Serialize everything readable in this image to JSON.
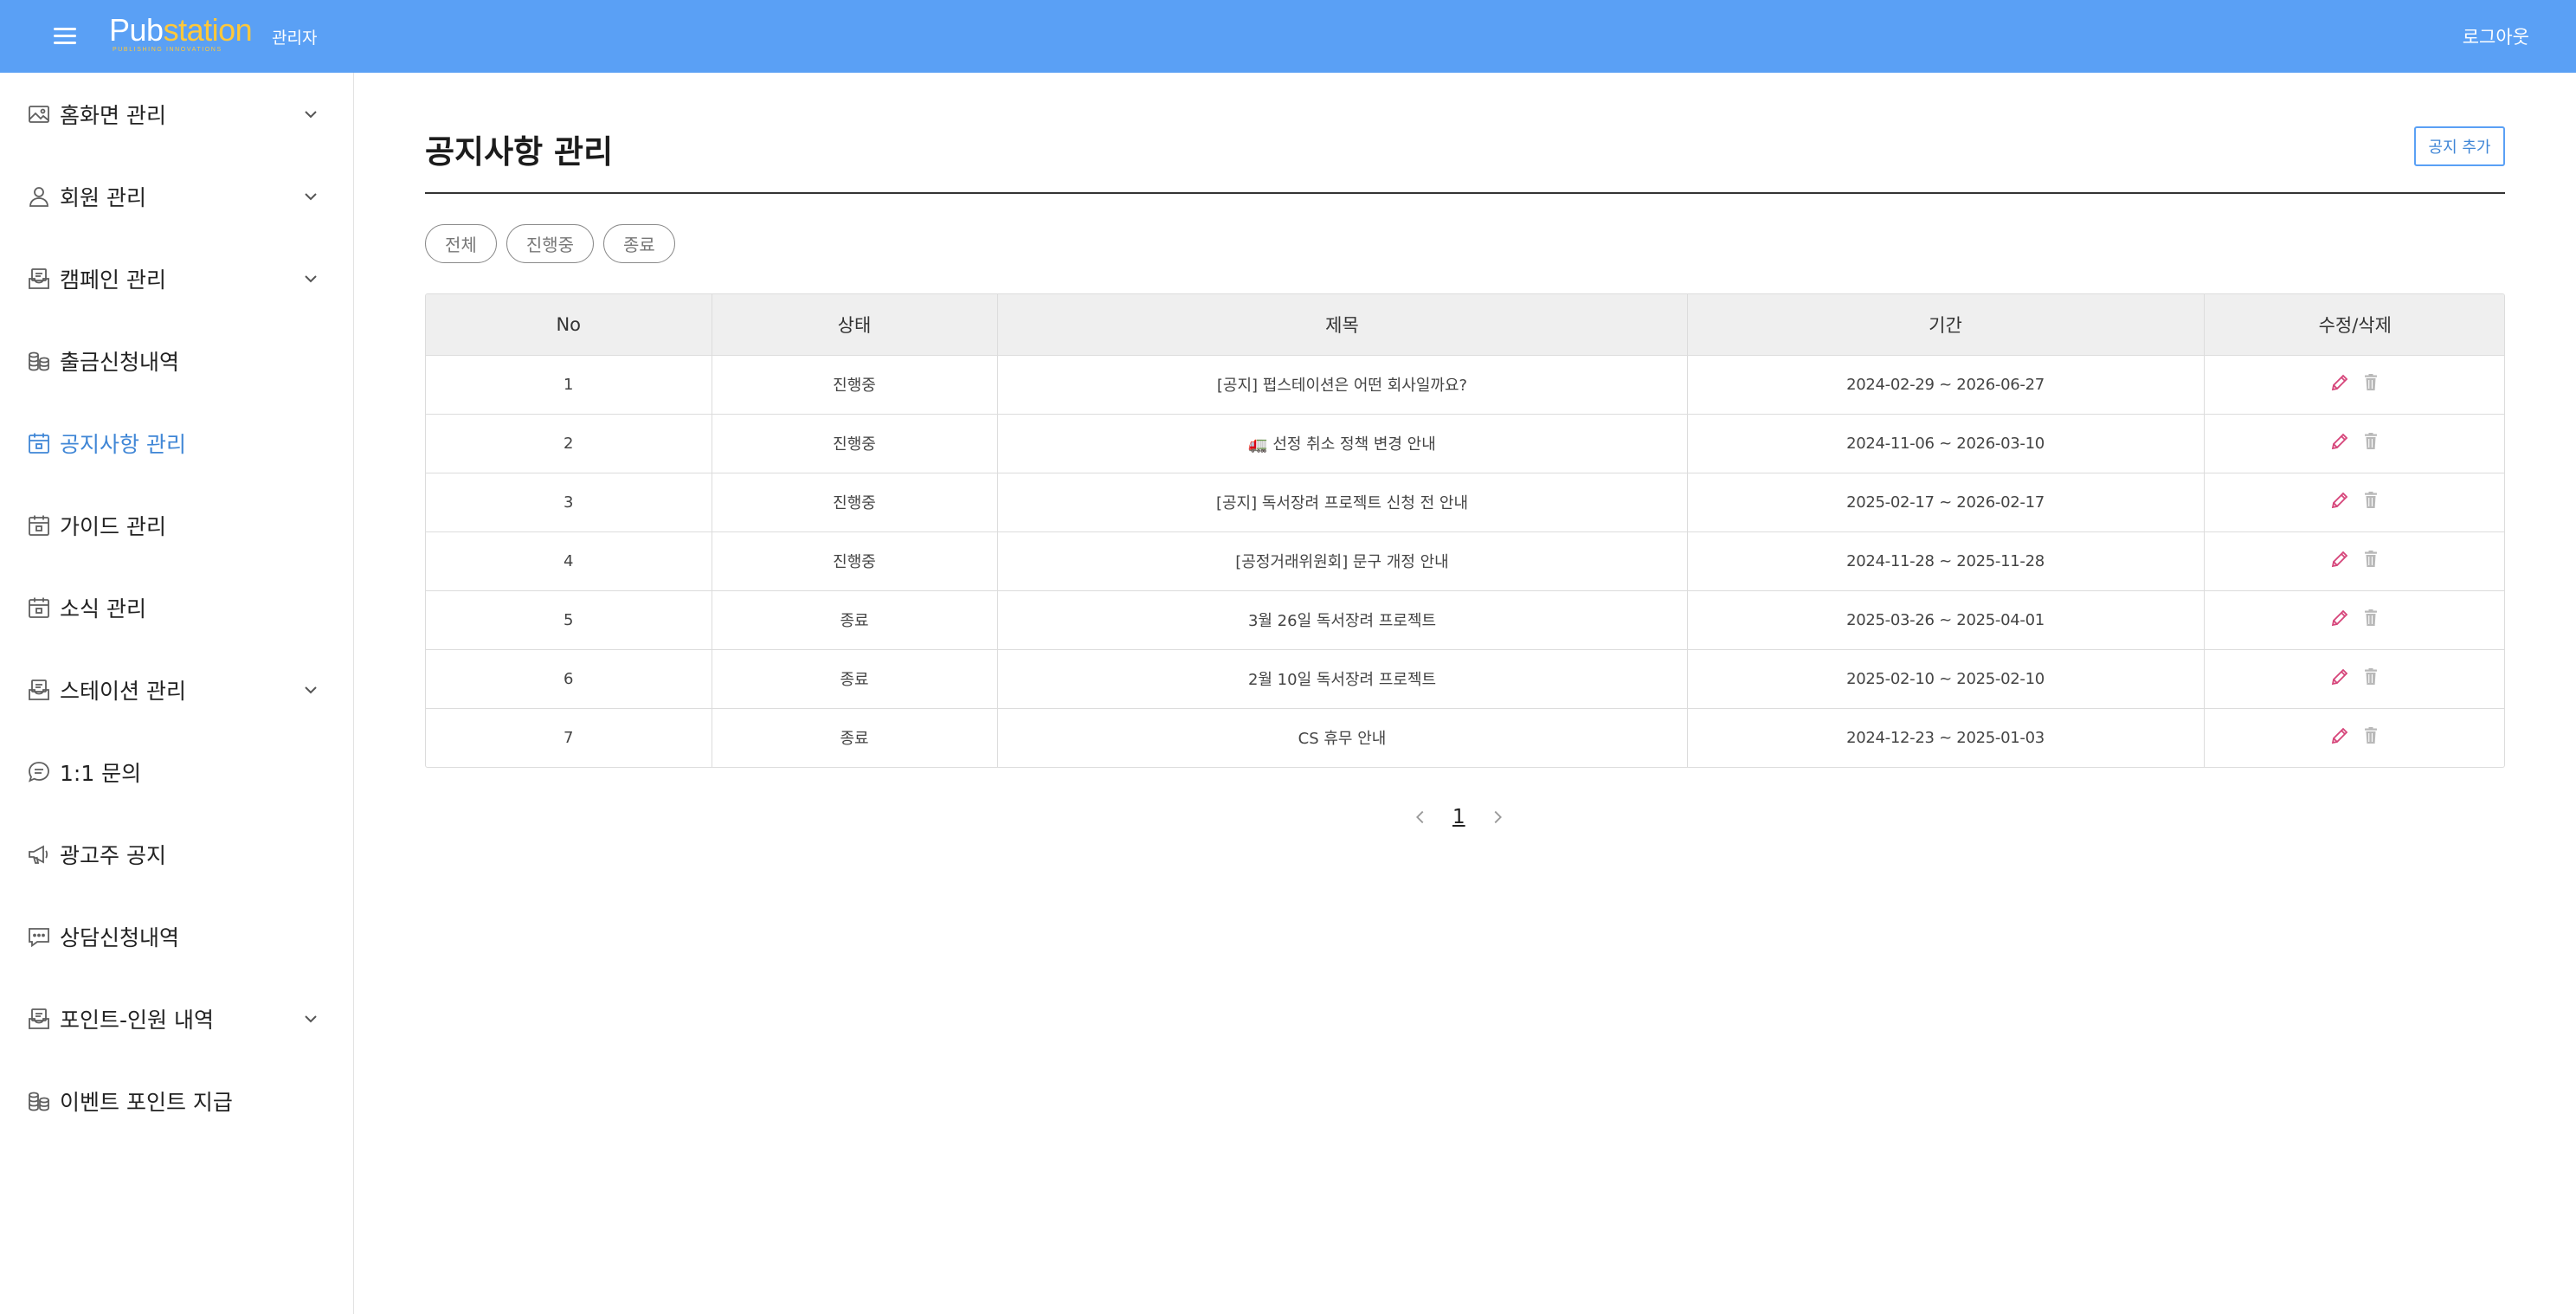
{
  "header": {
    "logo_text_a": "Pub",
    "logo_text_b": "station",
    "logo_tagline": "PUBLISHING INNOVATIONS",
    "role": "관리자",
    "logout": "로그아웃",
    "bar_color": "#5aa0f5"
  },
  "sidebar": {
    "items": [
      {
        "label": "홈화면 관리",
        "icon": "image-icon",
        "expandable": true,
        "active": false
      },
      {
        "label": "회원 관리",
        "icon": "user-icon",
        "expandable": true,
        "active": false
      },
      {
        "label": "캠페인 관리",
        "icon": "inbox-icon",
        "expandable": true,
        "active": false
      },
      {
        "label": "출금신청내역",
        "icon": "coins-icon",
        "expandable": false,
        "active": false
      },
      {
        "label": "공지사항 관리",
        "icon": "calendar-icon",
        "expandable": false,
        "active": true
      },
      {
        "label": "가이드 관리",
        "icon": "calendar-icon",
        "expandable": false,
        "active": false
      },
      {
        "label": "소식 관리",
        "icon": "calendar-icon",
        "expandable": false,
        "active": false
      },
      {
        "label": "스테이션 관리",
        "icon": "inbox-icon",
        "expandable": true,
        "active": false
      },
      {
        "label": "1:1 문의",
        "icon": "chat-icon",
        "expandable": false,
        "active": false
      },
      {
        "label": "광고주 공지",
        "icon": "megaphone-icon",
        "expandable": false,
        "active": false
      },
      {
        "label": "상담신청내역",
        "icon": "message-dots-icon",
        "expandable": false,
        "active": false
      },
      {
        "label": "포인트-인원 내역",
        "icon": "inbox-icon",
        "expandable": true,
        "active": false
      },
      {
        "label": "이벤트 포인트 지급",
        "icon": "coins-icon",
        "expandable": false,
        "active": false
      }
    ],
    "active_color": "#3f86d6"
  },
  "main": {
    "title": "공지사항 관리",
    "add_button": "공지 추가",
    "filters": [
      "전체",
      "진행중",
      "종료"
    ],
    "table": {
      "columns": [
        "No",
        "상태",
        "제목",
        "기간",
        "수정/삭제"
      ],
      "rows": [
        {
          "no": "1",
          "status": "진행중",
          "title": "[공지] 펍스테이션은 어떤 회사일까요?",
          "period": "2024-02-29 ~ 2026-06-27"
        },
        {
          "no": "2",
          "status": "진행중",
          "title": "🚛 선정 취소 정책 변경 안내",
          "period": "2024-11-06 ~ 2026-03-10"
        },
        {
          "no": "3",
          "status": "진행중",
          "title": "[공지] 독서장려 프로젝트 신청 전 안내",
          "period": "2025-02-17 ~ 2026-02-17"
        },
        {
          "no": "4",
          "status": "진행중",
          "title": "[공정거래위원회] 문구 개정 안내",
          "period": "2024-11-28 ~ 2025-11-28"
        },
        {
          "no": "5",
          "status": "종료",
          "title": "3월 26일 독서장려 프로젝트",
          "period": "2025-03-26 ~ 2025-04-01"
        },
        {
          "no": "6",
          "status": "종료",
          "title": "2월 10일 독서장려 프로젝트",
          "period": "2025-02-10 ~ 2025-02-10"
        },
        {
          "no": "7",
          "status": "종료",
          "title": "CS 휴무 안내",
          "period": "2024-12-23 ~ 2025-01-03"
        }
      ],
      "edit_icon": "pencil-icon",
      "delete_icon": "trash-icon",
      "edit_color": "#d6457a",
      "delete_color": "#b9b9b9"
    },
    "pagination": {
      "current": "1"
    }
  }
}
